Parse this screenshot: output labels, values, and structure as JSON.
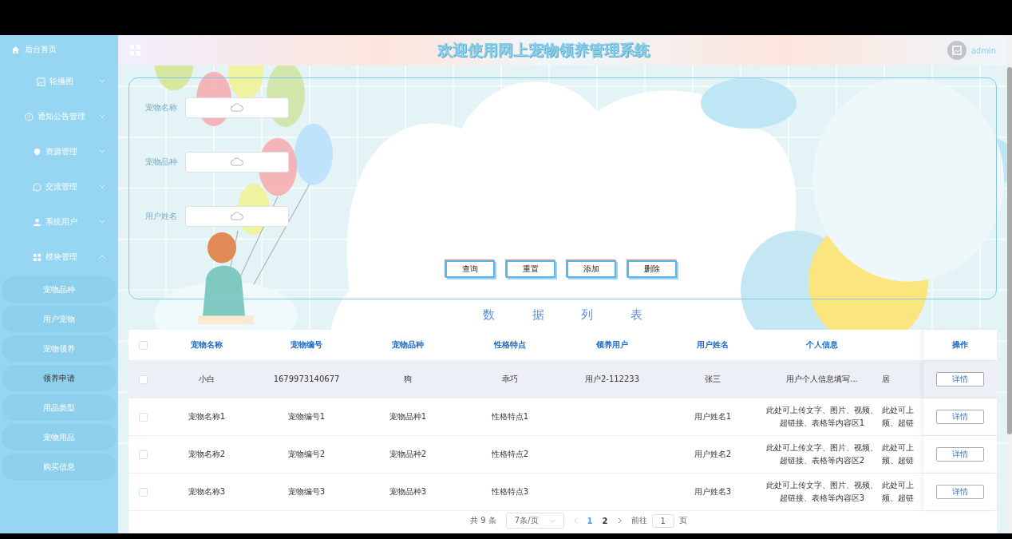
{
  "sidebar": {
    "home": "后台首页",
    "menus": [
      {
        "label": "轮播图",
        "expanded": false
      },
      {
        "label": "通知公告管理",
        "expanded": false
      },
      {
        "label": "资源管理",
        "expanded": false
      },
      {
        "label": "交流管理",
        "expanded": false
      },
      {
        "label": "系统用户",
        "expanded": false
      },
      {
        "label": "模块管理",
        "expanded": true
      }
    ],
    "items": [
      {
        "label": "宠物品种",
        "selected": false
      },
      {
        "label": "用户宠物",
        "selected": false
      },
      {
        "label": "宠物领养",
        "selected": false
      },
      {
        "label": "领养申请",
        "selected": true
      },
      {
        "label": "用品类型",
        "selected": false
      },
      {
        "label": "宠物用品",
        "selected": false
      },
      {
        "label": "购买信息",
        "selected": false
      }
    ]
  },
  "header": {
    "title": "欢迎使用网上宠物领养管理系统",
    "user": "admin"
  },
  "search_form": {
    "fields": [
      {
        "label": "宠物名称"
      },
      {
        "label": "宠物品种"
      },
      {
        "label": "用户姓名"
      }
    ],
    "buttons": [
      "查询",
      "重置",
      "添加",
      "删除"
    ]
  },
  "list_title": "数 据 列 表",
  "table": {
    "all_checked": false,
    "columns": [
      "宠物名称",
      "宠物编号",
      "宠物品种",
      "性格特点",
      "领养用户",
      "用户姓名",
      "个人信息",
      "操作"
    ],
    "rows": [
      {
        "highlighted": true,
        "checked": false,
        "cells": [
          "小白",
          "1679973140677",
          "狗",
          "乖巧",
          "用户2-112233",
          "张三",
          "用户个人信息填写...",
          "居"
        ],
        "action": "详情"
      },
      {
        "highlighted": false,
        "checked": false,
        "cells": [
          "宠物名称1",
          "宠物编号1",
          "宠物品种1",
          "性格特点1",
          null,
          "用户姓名1",
          "此处可上传文字、图片、视频、超链接、表格等内容区1",
          "此处可上频、超链"
        ],
        "action": "详情"
      },
      {
        "highlighted": false,
        "checked": false,
        "cells": [
          "宠物名称2",
          "宠物编号2",
          "宠物品种2",
          "性格特点2",
          null,
          "用户姓名2",
          "此处可上传文字、图片、视频、超链接、表格等内容区2",
          "此处可上频、超链"
        ],
        "action": "详情"
      },
      {
        "highlighted": false,
        "checked": false,
        "cells": [
          "宠物名称3",
          "宠物编号3",
          "宠物品种3",
          "性格特点3",
          null,
          "用户姓名3",
          "此处可上传文字、图片、视频、超链接、表格等内容区3",
          "此处可上频、超链"
        ],
        "action": "详情"
      }
    ]
  },
  "pagination": {
    "total": "共 9 条",
    "page_size": "7条/页",
    "pages": [
      {
        "label": "1",
        "selected": true
      },
      {
        "label": "2",
        "selected": false
      }
    ],
    "goto_label": "前往",
    "goto_value": "1",
    "page_suffix": "页"
  }
}
